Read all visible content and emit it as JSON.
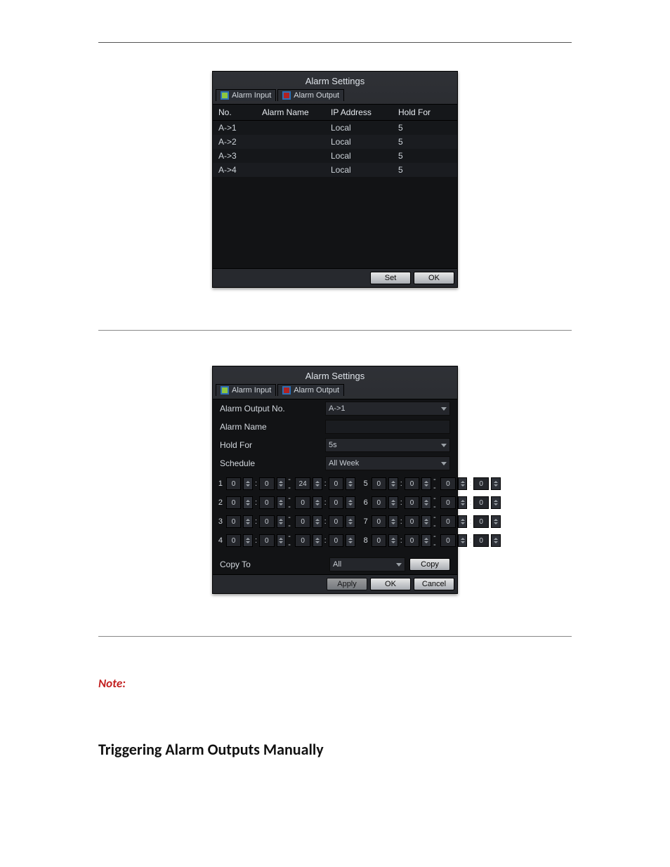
{
  "dialog1": {
    "title": "Alarm Settings",
    "tabs": [
      {
        "label": "Alarm Input"
      },
      {
        "label": "Alarm Output"
      }
    ],
    "columns": {
      "no": "No.",
      "name": "Alarm Name",
      "ip": "IP Address",
      "hold": "Hold For"
    },
    "rows": [
      {
        "no": "A->1",
        "name": "",
        "ip": "Local",
        "hold": "5"
      },
      {
        "no": "A->2",
        "name": "",
        "ip": "Local",
        "hold": "5"
      },
      {
        "no": "A->3",
        "name": "",
        "ip": "Local",
        "hold": "5"
      },
      {
        "no": "A->4",
        "name": "",
        "ip": "Local",
        "hold": "5"
      }
    ],
    "buttons": {
      "set": "Set",
      "ok": "OK"
    }
  },
  "dialog2": {
    "title": "Alarm Settings",
    "tabs": [
      {
        "label": "Alarm Input"
      },
      {
        "label": "Alarm Output"
      }
    ],
    "fields": {
      "output_no_label": "Alarm Output No.",
      "output_no_value": "A->1",
      "name_label": "Alarm Name",
      "name_value": "",
      "hold_label": "Hold For",
      "hold_value": "5s",
      "schedule_label": "Schedule",
      "schedule_value": "All Week"
    },
    "schedule_rows": [
      {
        "idx": "1",
        "a1": "0",
        "a2": "0",
        "a3": "24",
        "a4": "0",
        "pair_idx": "5",
        "b1": "0",
        "b2": "0",
        "b3": "0",
        "b4": "0"
      },
      {
        "idx": "2",
        "a1": "0",
        "a2": "0",
        "a3": "0",
        "a4": "0",
        "pair_idx": "6",
        "b1": "0",
        "b2": "0",
        "b3": "0",
        "b4": "0"
      },
      {
        "idx": "3",
        "a1": "0",
        "a2": "0",
        "a3": "0",
        "a4": "0",
        "pair_idx": "7",
        "b1": "0",
        "b2": "0",
        "b3": "0",
        "b4": "0"
      },
      {
        "idx": "4",
        "a1": "0",
        "a2": "0",
        "a3": "0",
        "a4": "0",
        "pair_idx": "8",
        "b1": "0",
        "b2": "0",
        "b3": "0",
        "b4": "0"
      }
    ],
    "copy": {
      "label": "Copy To",
      "value": "All",
      "btn": "Copy"
    },
    "buttons": {
      "apply": "Apply",
      "ok": "OK",
      "cancel": "Cancel"
    }
  },
  "doc": {
    "note_label": "Note:",
    "section_title": "Triggering Alarm Outputs Manually"
  }
}
